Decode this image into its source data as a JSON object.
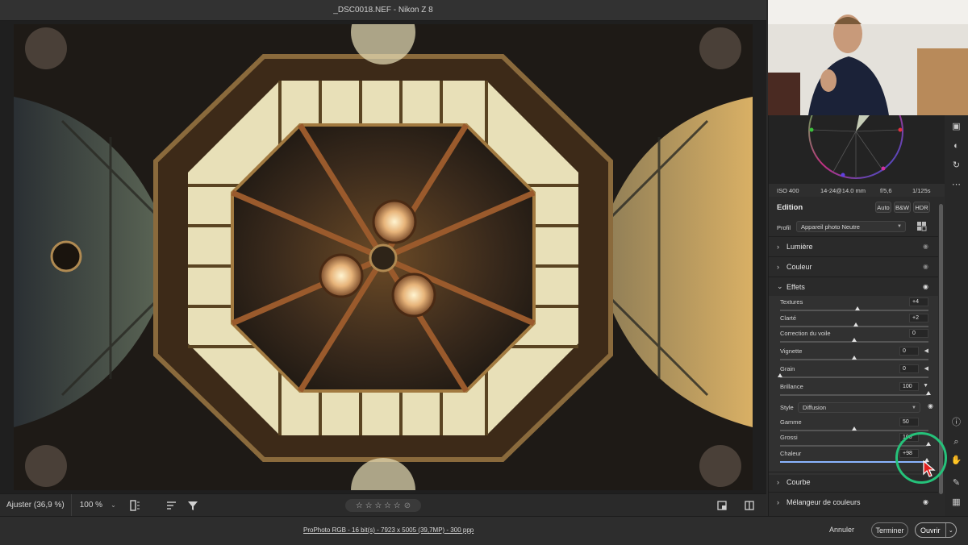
{
  "window": {
    "title": "_DSC0018.NEF  -  Nikon Z 8"
  },
  "toolbar": {
    "zoom_fit": "Ajuster (36,9 %)",
    "zoom_pct": "100 %",
    "zoom_caret": "⌄"
  },
  "rating": {
    "stars": "☆ ☆ ☆ ☆ ☆",
    "reject": "⊘"
  },
  "status": {
    "file_info": "ProPhoto RGB - 16 bit(s) - 7923 x 5005 (39,7MP) - 300 ppp",
    "cancel": "Annuler",
    "done": "Terminer",
    "open": "Ouvrir",
    "open_caret": "⌄"
  },
  "meta": {
    "iso": "ISO 400",
    "lens": "14-24@14.0 mm",
    "aperture": "f/5,6",
    "shutter": "1/125s"
  },
  "edit": {
    "title": "Edition",
    "auto": "Auto",
    "bw": "B&W",
    "hdr": "HDR",
    "profile_label": "Profil",
    "profile_value": "Appareil photo Neutre"
  },
  "sections": {
    "light": "Lumière",
    "color": "Couleur",
    "effects": "Effets",
    "curve": "Courbe",
    "mixer": "Mélangeur de couleurs"
  },
  "effects": {
    "style_label": "Style",
    "style_value": "Diffusion",
    "sliders": [
      {
        "label": "Textures",
        "value": "+4",
        "pos": 0.52
      },
      {
        "label": "Clarté",
        "value": "+2",
        "pos": 0.51
      },
      {
        "label": "Correction du voile",
        "value": "0",
        "pos": 0.5
      },
      {
        "label": "Vignette",
        "value": "0",
        "pos": 0.5,
        "mark": "◀"
      },
      {
        "label": "Grain",
        "value": "0",
        "pos": 0.0,
        "mark": "◀"
      },
      {
        "label": "Brillance",
        "value": "100",
        "pos": 1.0,
        "mark": "▼"
      },
      {
        "label": "Gamme",
        "value": "50",
        "pos": 0.5
      },
      {
        "label": "Grossi",
        "value": "100",
        "pos": 1.0
      },
      {
        "label": "Chaleur",
        "value": "+98",
        "pos": 0.99
      }
    ]
  },
  "colors": {
    "accent": "#8ab4ff",
    "highlight": "#25c27a",
    "cursor": "#e02020"
  }
}
